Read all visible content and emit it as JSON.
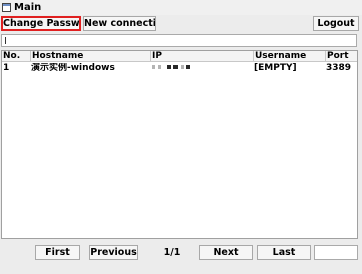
{
  "window": {
    "title": "Main"
  },
  "toolbar": {
    "change_password_label": "Change Password",
    "new_connection_label": "New connection",
    "logout_label": "Logout"
  },
  "search": {
    "value": "",
    "placeholder": ""
  },
  "table": {
    "columns": [
      "No.",
      "Hostname",
      "IP",
      "Username",
      "Port"
    ],
    "rows": [
      {
        "no": "1",
        "hostname": "演示实例-windows",
        "ip": "",
        "username": "[EMPTY]",
        "port": "3389"
      }
    ]
  },
  "pagination": {
    "first_label": "First",
    "previous_label": "Previous",
    "page_info": "1/1",
    "next_label": "Next",
    "last_label": "Last",
    "page_input_value": ""
  },
  "colors": {
    "highlight_border": "#e02020",
    "title_icon_bar": "#6e8fc6"
  }
}
